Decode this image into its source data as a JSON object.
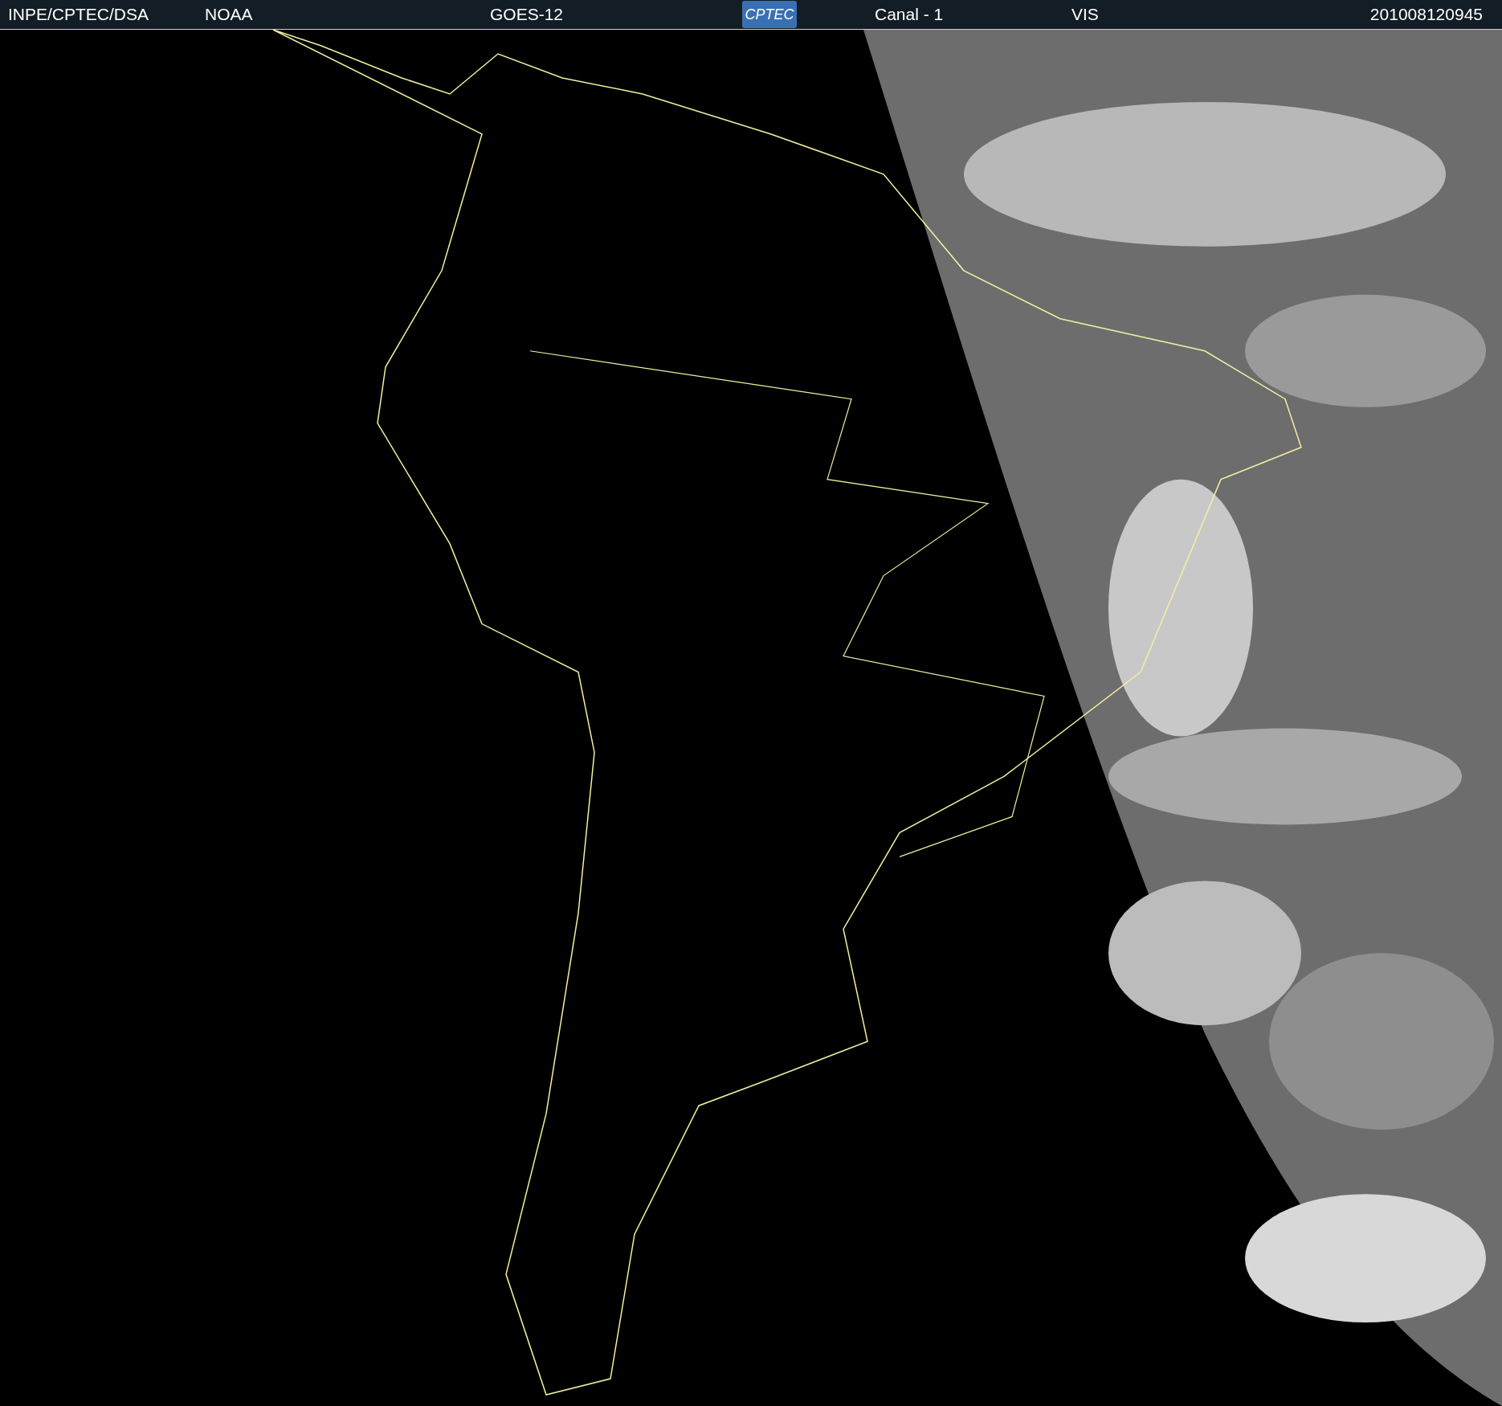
{
  "header": {
    "items": [
      {
        "kind": "text",
        "text": "INPE/CPTEC/DSA"
      },
      {
        "kind": "text",
        "text": "NOAA"
      },
      {
        "kind": "text",
        "text": "GOES-12"
      },
      {
        "kind": "logo",
        "text": "CPTEC"
      },
      {
        "kind": "text",
        "text": "Canal - 1"
      },
      {
        "kind": "text",
        "text": "VIS"
      },
      {
        "kind": "text",
        "text": "201008120945"
      }
    ]
  }
}
